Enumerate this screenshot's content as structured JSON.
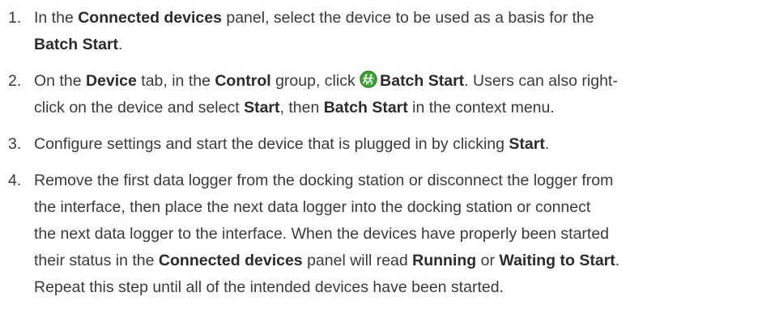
{
  "steps": [
    {
      "num": "1.",
      "segments": [
        {
          "t": "In the "
        },
        {
          "t": "Connected devices",
          "b": true
        },
        {
          "t": " panel, select the device to be used as a basis for the "
        },
        {
          "br": true
        },
        {
          "t": "Batch Start",
          "b": true
        },
        {
          "t": "."
        }
      ]
    },
    {
      "num": "2.",
      "segments": [
        {
          "t": "On the "
        },
        {
          "t": "Device",
          "b": true
        },
        {
          "t": " tab, in the "
        },
        {
          "t": "Control",
          "b": true
        },
        {
          "t": " group, click "
        },
        {
          "icon": "batch-start-icon"
        },
        {
          "t": "Batch Start",
          "b": true
        },
        {
          "t": ". Users can also right-"
        },
        {
          "br": true
        },
        {
          "t": "click on the device and select "
        },
        {
          "t": "Start",
          "b": true
        },
        {
          "t": ", then "
        },
        {
          "t": "Batch Start",
          "b": true
        },
        {
          "t": " in the context menu."
        }
      ]
    },
    {
      "num": "3.",
      "segments": [
        {
          "t": "Configure settings and start the device that is plugged in by clicking "
        },
        {
          "t": "Start",
          "b": true
        },
        {
          "t": "."
        }
      ]
    },
    {
      "num": "4.",
      "segments": [
        {
          "t": "Remove the first data logger from the docking station or disconnect the logger from"
        },
        {
          "br": true
        },
        {
          "t": "the interface, then place the next data logger into the docking station or connect"
        },
        {
          "br": true
        },
        {
          "t": "the next data logger to the interface. When the devices have properly been started"
        },
        {
          "br": true
        },
        {
          "t": "their status in the "
        },
        {
          "t": "Connected devices",
          "b": true
        },
        {
          "t": " panel will read "
        },
        {
          "t": "Running",
          "b": true
        },
        {
          "t": " or "
        },
        {
          "t": "Waiting to Start",
          "b": true
        },
        {
          "t": "."
        },
        {
          "br": true
        },
        {
          "t": "Repeat this step until all of the intended devices have been started."
        }
      ]
    }
  ],
  "icon_colors": {
    "batch_start_fill": "#3fa535",
    "batch_start_ring": "#1f6e1a",
    "batch_start_glyph": "#ffffff"
  }
}
